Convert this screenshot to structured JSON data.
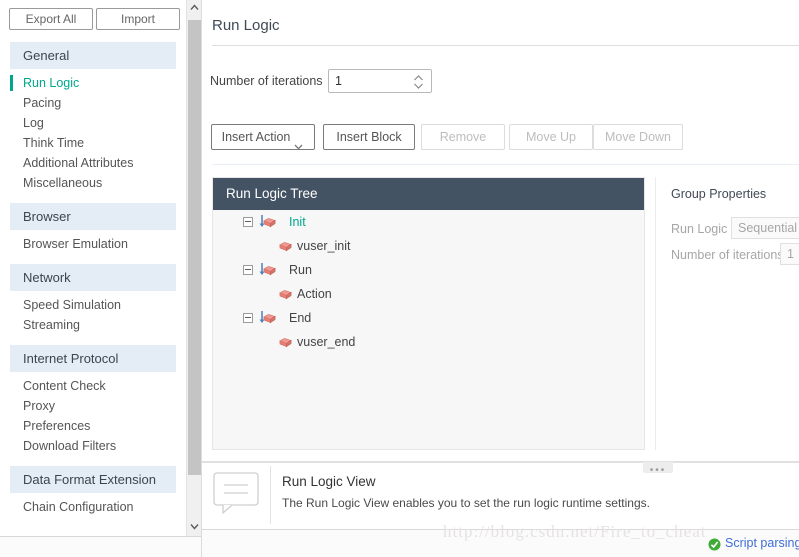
{
  "sidebar": {
    "toolbar": {
      "export_label": "Export All",
      "import_label": "Import"
    },
    "sections": [
      {
        "group": "General",
        "items": [
          {
            "label": "Run Logic",
            "selected": true
          },
          {
            "label": "Pacing",
            "selected": false
          },
          {
            "label": "Log",
            "selected": false
          },
          {
            "label": "Think Time",
            "selected": false
          },
          {
            "label": "Additional Attributes",
            "selected": false
          },
          {
            "label": "Miscellaneous",
            "selected": false
          }
        ]
      },
      {
        "group": "Browser",
        "items": [
          {
            "label": "Browser Emulation",
            "selected": false
          }
        ]
      },
      {
        "group": "Network",
        "items": [
          {
            "label": "Speed Simulation",
            "selected": false
          },
          {
            "label": "Streaming",
            "selected": false
          }
        ]
      },
      {
        "group": "Internet Protocol",
        "items": [
          {
            "label": "Content Check",
            "selected": false
          },
          {
            "label": "Proxy",
            "selected": false
          },
          {
            "label": "Preferences",
            "selected": false
          },
          {
            "label": "Download Filters",
            "selected": false
          }
        ]
      },
      {
        "group": "Data Format Extension",
        "items": [
          {
            "label": "Chain Configuration",
            "selected": false
          }
        ]
      }
    ]
  },
  "main": {
    "page_title": "Run Logic",
    "iterations": {
      "label": "Number of iterations",
      "value": "1"
    },
    "buttons": [
      {
        "id": "b-insert-action",
        "label": "Insert Action",
        "enabled": true,
        "caret": true
      },
      {
        "id": "b-insert-block",
        "label": "Insert Block",
        "enabled": true,
        "caret": false
      },
      {
        "id": "b-remove",
        "label": "Remove",
        "enabled": false,
        "caret": false
      },
      {
        "id": "b-move-up",
        "label": "Move Up",
        "enabled": false,
        "caret": false
      },
      {
        "id": "b-move-down",
        "label": "Move Down",
        "enabled": false,
        "caret": false
      }
    ],
    "tree": {
      "header": "Run Logic Tree",
      "nodes": [
        {
          "label": "Init",
          "level": 1,
          "icon": "group-block-icon",
          "selected": true
        },
        {
          "label": "vuser_init",
          "level": 2,
          "icon": "block-icon",
          "selected": false
        },
        {
          "label": "Run",
          "level": 1,
          "icon": "group-block-icon",
          "selected": false
        },
        {
          "label": "Action",
          "level": 2,
          "icon": "block-icon",
          "selected": false
        },
        {
          "label": "End",
          "level": 1,
          "icon": "group-block-icon",
          "selected": false
        },
        {
          "label": "vuser_end",
          "level": 2,
          "icon": "block-icon",
          "selected": false
        }
      ]
    },
    "group_properties": {
      "title": "Group Properties",
      "run_logic_label": "Run Logic",
      "run_logic_value": "Sequential",
      "iterations_label": "Number of iterations",
      "iterations_value": "1"
    },
    "info": {
      "title": "Run Logic View",
      "description": "The Run Logic View enables you to set the run logic runtime settings."
    },
    "status": {
      "text": "Script parsing"
    },
    "watermark": "http://blog.csdn.net/Fire_to_cheat"
  },
  "colors": {
    "accent_teal": "#00a78e",
    "tree_header": "#445363",
    "group_header_bg": "#e4ecf5",
    "status_link": "#3f6ed6"
  }
}
